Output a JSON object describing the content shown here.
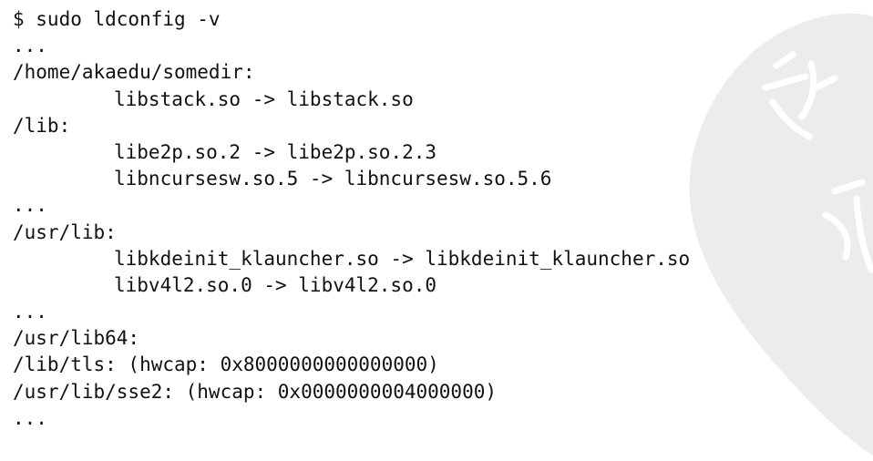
{
  "terminal": {
    "lines": [
      {
        "text": "$ sudo ldconfig -v",
        "indent": false
      },
      {
        "text": "...",
        "indent": false
      },
      {
        "text": "/home/akaedu/somedir:",
        "indent": false
      },
      {
        "text": "libstack.so -> libstack.so",
        "indent": true
      },
      {
        "text": "/lib:",
        "indent": false
      },
      {
        "text": "libe2p.so.2 -> libe2p.so.2.3",
        "indent": true
      },
      {
        "text": "libncursesw.so.5 -> libncursesw.so.5.6",
        "indent": true
      },
      {
        "text": "...",
        "indent": false
      },
      {
        "text": "/usr/lib:",
        "indent": false
      },
      {
        "text": "libkdeinit_klauncher.so -> libkdeinit_klauncher.so",
        "indent": true
      },
      {
        "text": "libv4l2.so.0 -> libv4l2.so.0",
        "indent": true
      },
      {
        "text": "...",
        "indent": false
      },
      {
        "text": "/usr/lib64:",
        "indent": false
      },
      {
        "text": "/lib/tls: (hwcap: 0x8000000000000000)",
        "indent": false
      },
      {
        "text": "/usr/lib/sse2: (hwcap: 0x0000000004000000)",
        "indent": false
      },
      {
        "text": "...",
        "indent": false
      }
    ]
  },
  "watermark": {
    "icon": "calligraphy-seal-watermark",
    "color": "#ececec"
  }
}
